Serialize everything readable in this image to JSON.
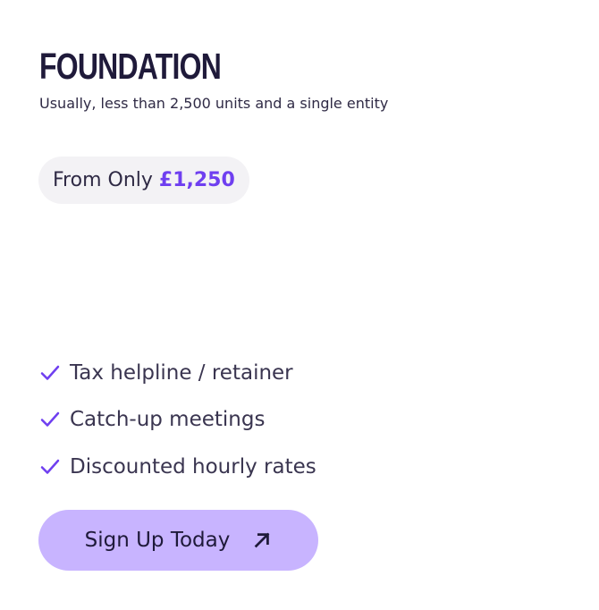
{
  "plan": {
    "title": "FOUNDATION",
    "subtitle": "Usually, less than 2,500 units and a single entity",
    "price": {
      "prefix": "From Only",
      "amount": "£1,250"
    },
    "features": [
      "Tax helpline / retainer",
      "Catch-up meetings",
      "Discounted hourly rates"
    ],
    "cta_label": "Sign Up Today"
  },
  "icons": {
    "check": "check-icon",
    "arrow": "arrow-up-right-icon"
  },
  "colors": {
    "accent": "#6f3ff0",
    "button": "#c8b4ff",
    "pill": "#f3f2f5",
    "text": "#1f1a3a"
  }
}
